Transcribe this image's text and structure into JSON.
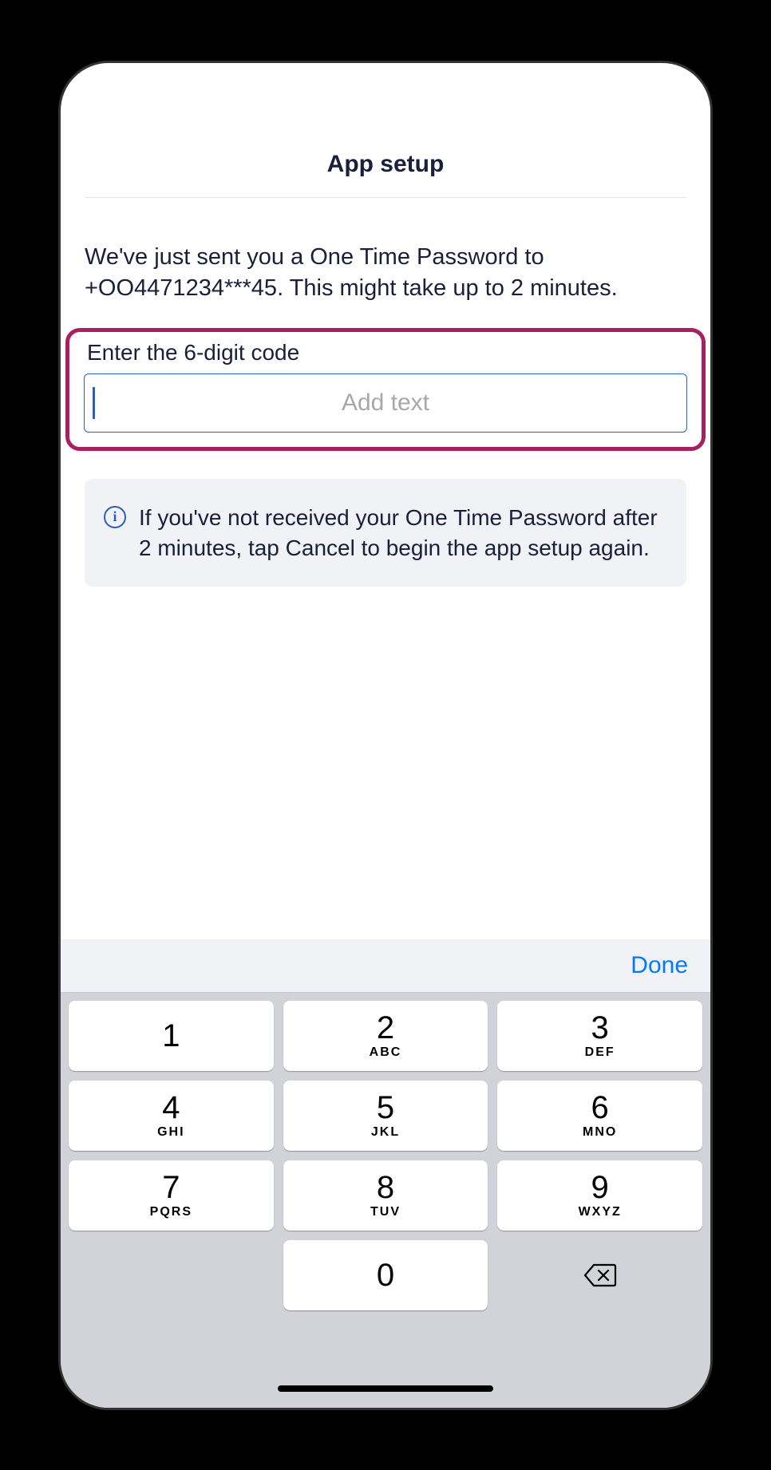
{
  "header": {
    "title": "App setup"
  },
  "message": "We've just sent you a One Time Password to +OO4471234***45. This might take up to 2 minutes.",
  "input": {
    "label": "Enter the 6-digit code",
    "placeholder": "Add text"
  },
  "info": {
    "text": "If you've not received your One Time Password after 2 minutes, tap Cancel to begin the app setup again."
  },
  "keyboard": {
    "done": "Done",
    "keys": [
      [
        {
          "digit": "1",
          "letters": ""
        },
        {
          "digit": "2",
          "letters": "ABC"
        },
        {
          "digit": "3",
          "letters": "DEF"
        }
      ],
      [
        {
          "digit": "4",
          "letters": "GHI"
        },
        {
          "digit": "5",
          "letters": "JKL"
        },
        {
          "digit": "6",
          "letters": "MNO"
        }
      ],
      [
        {
          "digit": "7",
          "letters": "PQRS"
        },
        {
          "digit": "8",
          "letters": "TUV"
        },
        {
          "digit": "9",
          "letters": "WXYZ"
        }
      ],
      [
        {
          "digit": "0",
          "letters": ""
        }
      ]
    ]
  }
}
